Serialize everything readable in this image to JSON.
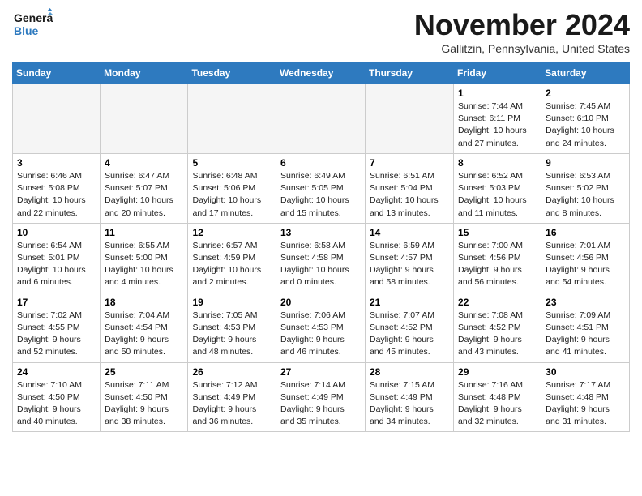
{
  "header": {
    "logo_line1": "General",
    "logo_line2": "Blue",
    "month": "November 2024",
    "location": "Gallitzin, Pennsylvania, United States"
  },
  "days_of_week": [
    "Sunday",
    "Monday",
    "Tuesday",
    "Wednesday",
    "Thursday",
    "Friday",
    "Saturday"
  ],
  "weeks": [
    [
      {
        "day": "",
        "info": ""
      },
      {
        "day": "",
        "info": ""
      },
      {
        "day": "",
        "info": ""
      },
      {
        "day": "",
        "info": ""
      },
      {
        "day": "",
        "info": ""
      },
      {
        "day": "1",
        "info": "Sunrise: 7:44 AM\nSunset: 6:11 PM\nDaylight: 10 hours and 27 minutes."
      },
      {
        "day": "2",
        "info": "Sunrise: 7:45 AM\nSunset: 6:10 PM\nDaylight: 10 hours and 24 minutes."
      }
    ],
    [
      {
        "day": "3",
        "info": "Sunrise: 6:46 AM\nSunset: 5:08 PM\nDaylight: 10 hours and 22 minutes."
      },
      {
        "day": "4",
        "info": "Sunrise: 6:47 AM\nSunset: 5:07 PM\nDaylight: 10 hours and 20 minutes."
      },
      {
        "day": "5",
        "info": "Sunrise: 6:48 AM\nSunset: 5:06 PM\nDaylight: 10 hours and 17 minutes."
      },
      {
        "day": "6",
        "info": "Sunrise: 6:49 AM\nSunset: 5:05 PM\nDaylight: 10 hours and 15 minutes."
      },
      {
        "day": "7",
        "info": "Sunrise: 6:51 AM\nSunset: 5:04 PM\nDaylight: 10 hours and 13 minutes."
      },
      {
        "day": "8",
        "info": "Sunrise: 6:52 AM\nSunset: 5:03 PM\nDaylight: 10 hours and 11 minutes."
      },
      {
        "day": "9",
        "info": "Sunrise: 6:53 AM\nSunset: 5:02 PM\nDaylight: 10 hours and 8 minutes."
      }
    ],
    [
      {
        "day": "10",
        "info": "Sunrise: 6:54 AM\nSunset: 5:01 PM\nDaylight: 10 hours and 6 minutes."
      },
      {
        "day": "11",
        "info": "Sunrise: 6:55 AM\nSunset: 5:00 PM\nDaylight: 10 hours and 4 minutes."
      },
      {
        "day": "12",
        "info": "Sunrise: 6:57 AM\nSunset: 4:59 PM\nDaylight: 10 hours and 2 minutes."
      },
      {
        "day": "13",
        "info": "Sunrise: 6:58 AM\nSunset: 4:58 PM\nDaylight: 10 hours and 0 minutes."
      },
      {
        "day": "14",
        "info": "Sunrise: 6:59 AM\nSunset: 4:57 PM\nDaylight: 9 hours and 58 minutes."
      },
      {
        "day": "15",
        "info": "Sunrise: 7:00 AM\nSunset: 4:56 PM\nDaylight: 9 hours and 56 minutes."
      },
      {
        "day": "16",
        "info": "Sunrise: 7:01 AM\nSunset: 4:56 PM\nDaylight: 9 hours and 54 minutes."
      }
    ],
    [
      {
        "day": "17",
        "info": "Sunrise: 7:02 AM\nSunset: 4:55 PM\nDaylight: 9 hours and 52 minutes."
      },
      {
        "day": "18",
        "info": "Sunrise: 7:04 AM\nSunset: 4:54 PM\nDaylight: 9 hours and 50 minutes."
      },
      {
        "day": "19",
        "info": "Sunrise: 7:05 AM\nSunset: 4:53 PM\nDaylight: 9 hours and 48 minutes."
      },
      {
        "day": "20",
        "info": "Sunrise: 7:06 AM\nSunset: 4:53 PM\nDaylight: 9 hours and 46 minutes."
      },
      {
        "day": "21",
        "info": "Sunrise: 7:07 AM\nSunset: 4:52 PM\nDaylight: 9 hours and 45 minutes."
      },
      {
        "day": "22",
        "info": "Sunrise: 7:08 AM\nSunset: 4:52 PM\nDaylight: 9 hours and 43 minutes."
      },
      {
        "day": "23",
        "info": "Sunrise: 7:09 AM\nSunset: 4:51 PM\nDaylight: 9 hours and 41 minutes."
      }
    ],
    [
      {
        "day": "24",
        "info": "Sunrise: 7:10 AM\nSunset: 4:50 PM\nDaylight: 9 hours and 40 minutes."
      },
      {
        "day": "25",
        "info": "Sunrise: 7:11 AM\nSunset: 4:50 PM\nDaylight: 9 hours and 38 minutes."
      },
      {
        "day": "26",
        "info": "Sunrise: 7:12 AM\nSunset: 4:49 PM\nDaylight: 9 hours and 36 minutes."
      },
      {
        "day": "27",
        "info": "Sunrise: 7:14 AM\nSunset: 4:49 PM\nDaylight: 9 hours and 35 minutes."
      },
      {
        "day": "28",
        "info": "Sunrise: 7:15 AM\nSunset: 4:49 PM\nDaylight: 9 hours and 34 minutes."
      },
      {
        "day": "29",
        "info": "Sunrise: 7:16 AM\nSunset: 4:48 PM\nDaylight: 9 hours and 32 minutes."
      },
      {
        "day": "30",
        "info": "Sunrise: 7:17 AM\nSunset: 4:48 PM\nDaylight: 9 hours and 31 minutes."
      }
    ]
  ]
}
